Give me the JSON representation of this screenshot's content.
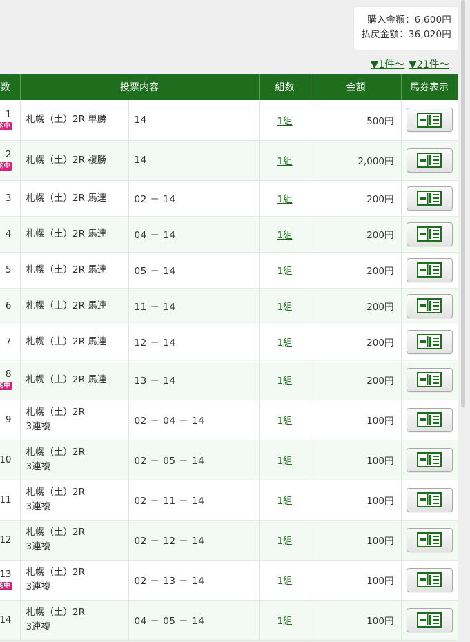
{
  "summary": {
    "purchase": "購入金額：6,600円",
    "payout": "払戻金額：36,020円"
  },
  "pager": [
    "▼1件～",
    "▼21件～"
  ],
  "columns": {
    "no": "件数",
    "content": "投票内容",
    "kumi": "組数",
    "amount": "金額",
    "ticket": "馬券表示"
  },
  "badge_text": "的中",
  "ticket_icon": "ticket-icon",
  "rows": [
    {
      "no": "1",
      "hit": true,
      "race": "札幌（土）2R 単勝",
      "combo": "14",
      "kumi": "1組",
      "amount": "500円"
    },
    {
      "no": "2",
      "hit": true,
      "race": "札幌（土）2R 複勝",
      "combo": "14",
      "kumi": "1組",
      "amount": "2,000円"
    },
    {
      "no": "3",
      "hit": false,
      "race": "札幌（土）2R 馬連",
      "combo": "02 － 14",
      "kumi": "1組",
      "amount": "200円"
    },
    {
      "no": "4",
      "hit": false,
      "race": "札幌（土）2R 馬連",
      "combo": "04 － 14",
      "kumi": "1組",
      "amount": "200円"
    },
    {
      "no": "5",
      "hit": false,
      "race": "札幌（土）2R 馬連",
      "combo": "05 － 14",
      "kumi": "1組",
      "amount": "200円"
    },
    {
      "no": "6",
      "hit": false,
      "race": "札幌（土）2R 馬連",
      "combo": "11 － 14",
      "kumi": "1組",
      "amount": "200円"
    },
    {
      "no": "7",
      "hit": false,
      "race": "札幌（土）2R 馬連",
      "combo": "12 － 14",
      "kumi": "1組",
      "amount": "200円"
    },
    {
      "no": "8",
      "hit": true,
      "race": "札幌（土）2R 馬連",
      "combo": "13 － 14",
      "kumi": "1組",
      "amount": "200円"
    },
    {
      "no": "9",
      "hit": false,
      "race": "札幌（土）2R",
      "race2": "3連複",
      "combo": "02 － 04 － 14",
      "kumi": "1組",
      "amount": "100円"
    },
    {
      "no": "10",
      "hit": false,
      "race": "札幌（土）2R",
      "race2": "3連複",
      "combo": "02 － 05 － 14",
      "kumi": "1組",
      "amount": "100円"
    },
    {
      "no": "11",
      "hit": false,
      "race": "札幌（土）2R",
      "race2": "3連複",
      "combo": "02 － 11 － 14",
      "kumi": "1組",
      "amount": "100円"
    },
    {
      "no": "12",
      "hit": false,
      "race": "札幌（土）2R",
      "race2": "3連複",
      "combo": "02 － 12 － 14",
      "kumi": "1組",
      "amount": "100円"
    },
    {
      "no": "13",
      "hit": true,
      "race": "札幌（土）2R",
      "race2": "3連複",
      "combo": "02 － 13 － 14",
      "kumi": "1組",
      "amount": "100円"
    },
    {
      "no": "14",
      "hit": false,
      "race": "札幌（土）2R",
      "race2": "3連複",
      "combo": "04 － 05 － 14",
      "kumi": "1組",
      "amount": "100円"
    }
  ]
}
